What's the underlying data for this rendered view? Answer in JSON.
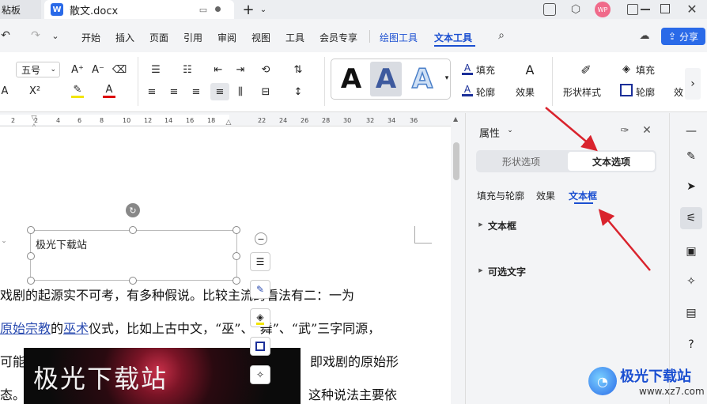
{
  "titlebar": {
    "left_tab": "粘板",
    "doc_tab": "散文.docx",
    "new_tab": "+",
    "logo_letter": "W",
    "avatar_text": "WP"
  },
  "menu": {
    "items": [
      "开始",
      "插入",
      "页面",
      "引用",
      "审阅",
      "视图",
      "工具",
      "会员专享"
    ],
    "drawing_tools": "绘图工具",
    "text_tools": "文本工具",
    "share": "分享"
  },
  "ribbon": {
    "font_size": "五号",
    "x_squared": "X²",
    "art_letters": [
      "A",
      "A",
      "A"
    ],
    "fill_label": "填充",
    "outline_label": "轮廓",
    "effect_label": "效果",
    "shape_style": "形状样式",
    "shape_fill": "填充",
    "shape_outline": "轮廓",
    "more": "效"
  },
  "ruler": {
    "numbers": [
      "2",
      "2",
      "4",
      "6",
      "8",
      "10",
      "12",
      "14",
      "16",
      "18",
      "22",
      "24",
      "26",
      "28",
      "30",
      "32",
      "34",
      "36"
    ]
  },
  "document": {
    "textbox_text": "极光下载站",
    "line1": "戏剧的起源实不可考，有多种假说。比较主流的看法有二：一为",
    "line2_link1": "原始宗教",
    "line2_mid": "的",
    "line2_link2": "巫术",
    "line2_rest": "仪式，比如上古中文，“巫”、“舞”、“武”三字同源，",
    "line3_start": "可能",
    "line3_end": "即戏剧的原始形",
    "line4_start": "态。",
    "line4_end": "这种说法主要依",
    "image_text": "极光下载站"
  },
  "panel": {
    "title": "属性",
    "tab_shape": "形状选项",
    "tab_text": "文本选项",
    "subtabs": [
      "填充与轮廓",
      "效果",
      "文本框"
    ],
    "section1": "文本框",
    "section2": "可选文字"
  },
  "watermark": {
    "name": "极光下载站",
    "url": "www.xz7.com"
  },
  "colors": {
    "accent": "#2a6ae8",
    "arrow": "#d9232d",
    "active_tab": "#1b4fd1"
  }
}
